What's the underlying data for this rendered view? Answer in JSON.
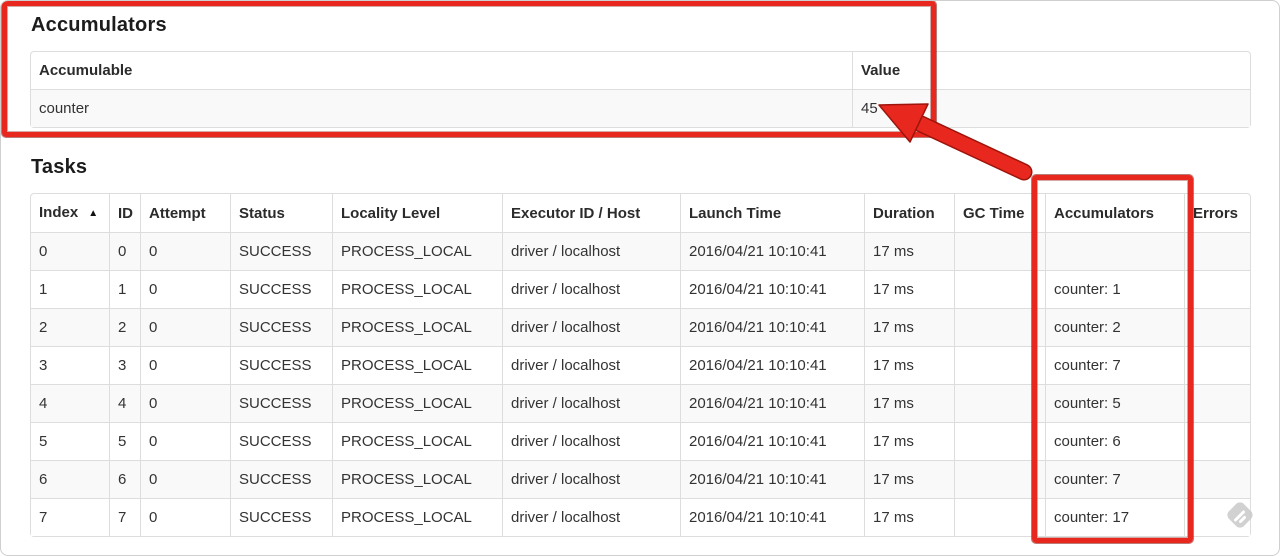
{
  "annotation": {
    "color": "#e8281e",
    "shapes": [
      "box-around-accumulators-section",
      "box-around-accumulators-column",
      "arrow-to-value-45"
    ]
  },
  "accumulators_section": {
    "title": "Accumulators",
    "table": {
      "headers": [
        "Accumulable",
        "Value"
      ],
      "rows": [
        [
          "counter",
          "45"
        ]
      ]
    }
  },
  "tasks_section": {
    "title": "Tasks",
    "table": {
      "sort_icon": "▲",
      "headers": [
        "Index",
        "ID",
        "Attempt",
        "Status",
        "Locality Level",
        "Executor ID / Host",
        "Launch Time",
        "Duration",
        "GC Time",
        "Accumulators",
        "Errors"
      ],
      "rows": [
        [
          "0",
          "0",
          "0",
          "SUCCESS",
          "PROCESS_LOCAL",
          "driver / localhost",
          "2016/04/21 10:10:41",
          "17 ms",
          "",
          "",
          ""
        ],
        [
          "1",
          "1",
          "0",
          "SUCCESS",
          "PROCESS_LOCAL",
          "driver / localhost",
          "2016/04/21 10:10:41",
          "17 ms",
          "",
          "counter: 1",
          ""
        ],
        [
          "2",
          "2",
          "0",
          "SUCCESS",
          "PROCESS_LOCAL",
          "driver / localhost",
          "2016/04/21 10:10:41",
          "17 ms",
          "",
          "counter: 2",
          ""
        ],
        [
          "3",
          "3",
          "0",
          "SUCCESS",
          "PROCESS_LOCAL",
          "driver / localhost",
          "2016/04/21 10:10:41",
          "17 ms",
          "",
          "counter: 7",
          ""
        ],
        [
          "4",
          "4",
          "0",
          "SUCCESS",
          "PROCESS_LOCAL",
          "driver / localhost",
          "2016/04/21 10:10:41",
          "17 ms",
          "",
          "counter: 5",
          ""
        ],
        [
          "5",
          "5",
          "0",
          "SUCCESS",
          "PROCESS_LOCAL",
          "driver / localhost",
          "2016/04/21 10:10:41",
          "17 ms",
          "",
          "counter: 6",
          ""
        ],
        [
          "6",
          "6",
          "0",
          "SUCCESS",
          "PROCESS_LOCAL",
          "driver / localhost",
          "2016/04/21 10:10:41",
          "17 ms",
          "",
          "counter: 7",
          ""
        ],
        [
          "7",
          "7",
          "0",
          "SUCCESS",
          "PROCESS_LOCAL",
          "driver / localhost",
          "2016/04/21 10:10:41",
          "17 ms",
          "",
          "counter: 17",
          ""
        ]
      ]
    }
  }
}
